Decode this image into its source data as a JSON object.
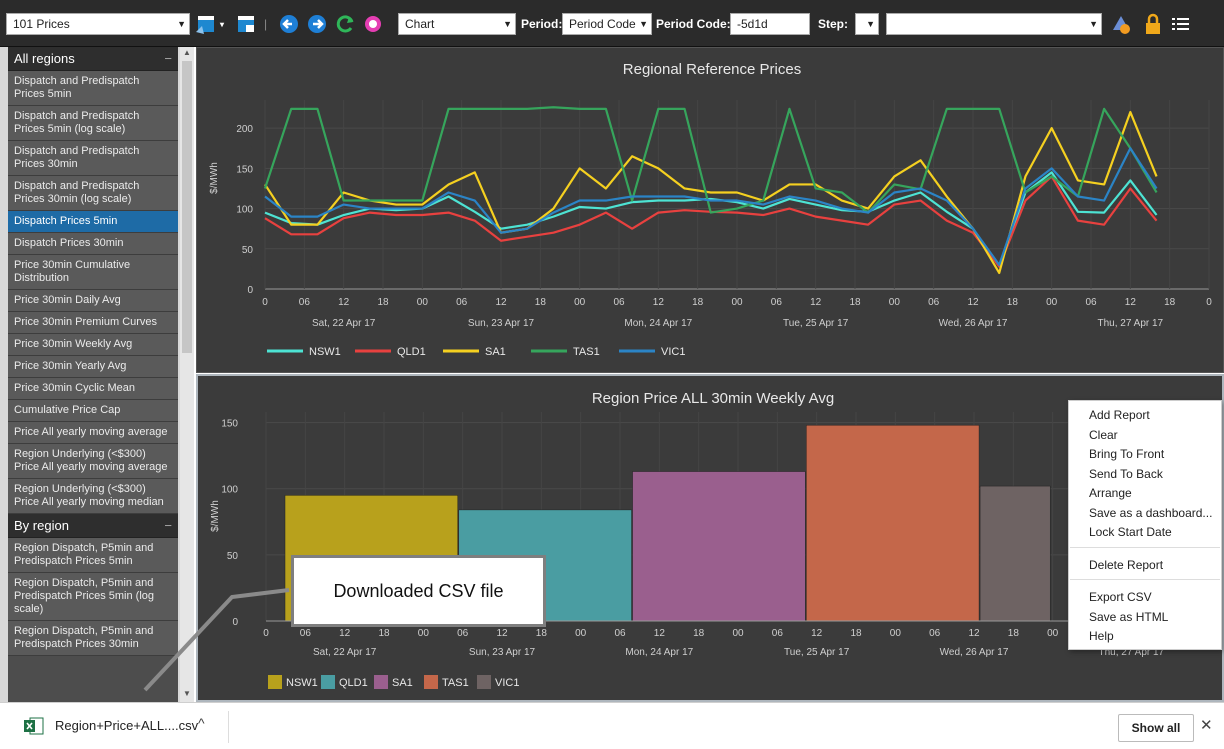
{
  "toolbar": {
    "report_select": "101 Prices",
    "view_select": "Chart",
    "period_label": "Period:",
    "period_value": "Period Code",
    "period_code_label": "Period Code:",
    "period_code_value": "-5d1d",
    "step_label": "Step:",
    "step_value": "",
    "extra_select": "",
    "icons": [
      "new-report-icon",
      "save-icon",
      "back-icon",
      "forward-icon",
      "refresh-icon",
      "record-icon",
      "share-icon",
      "lock-icon",
      "menu-icon"
    ]
  },
  "sidebar": {
    "groups": [
      {
        "title": "All regions",
        "items": [
          "Dispatch and Predispatch Prices 5min",
          "Dispatch and Predispatch Prices 5min (log scale)",
          "Dispatch and Predispatch Prices 30min",
          "Dispatch and Predispatch Prices 30min (log scale)",
          "Dispatch Prices 5min",
          "Dispatch Prices 30min",
          "Price 30min Cumulative Distribution",
          "Price 30min Daily Avg",
          "Price 30min Premium Curves",
          "Price 30min Weekly Avg",
          "Price 30min Yearly Avg",
          "Price 30min Cyclic Mean",
          "Cumulative Price Cap",
          "Price All yearly moving average",
          "Region Underlying (<$300) Price All yearly moving average",
          "Region Underlying (<$300) Price All yearly moving median"
        ]
      },
      {
        "title": "By region",
        "items": [
          "Region Dispatch, P5min and Predispatch Prices 5min",
          "Region Dispatch, P5min and Predispatch Prices 5min (log scale)",
          "Region Dispatch, P5min and Predispatch Prices 30min"
        ]
      }
    ],
    "selected_index": 4
  },
  "chart_data": [
    {
      "type": "line",
      "title": "Regional Reference Prices",
      "ylabel": "$/MWh",
      "ylim": [
        0,
        235
      ],
      "yticks": [
        0,
        50,
        100,
        150,
        200
      ],
      "xlim": [
        0,
        144
      ],
      "xticks": [
        "0",
        "06",
        "12",
        "18",
        "00",
        "06",
        "12",
        "18",
        "00",
        "06",
        "12",
        "18",
        "00",
        "06",
        "12",
        "18",
        "00",
        "06",
        "12",
        "18",
        "00",
        "06",
        "12",
        "18",
        "0"
      ],
      "day_labels": [
        "Sat, 22 Apr 17",
        "Sun, 23 Apr 17",
        "Mon, 24 Apr 17",
        "Tue, 25 Apr 17",
        "Wed, 26 Apr 17",
        "Thu, 27 Apr 17"
      ],
      "x_hours": [
        0,
        4,
        8,
        12,
        16,
        20,
        24,
        28,
        32,
        36,
        40,
        44,
        48,
        52,
        56,
        60,
        64,
        68,
        72,
        76,
        80,
        84,
        88,
        92,
        96,
        100,
        104,
        108,
        112,
        116,
        120,
        124,
        128,
        132,
        136
      ],
      "series": [
        {
          "name": "NSW1",
          "color": "#4de3d3",
          "values": [
            95,
            82,
            80,
            92,
            100,
            98,
            100,
            115,
            96,
            75,
            80,
            90,
            102,
            100,
            108,
            110,
            110,
            112,
            108,
            100,
            112,
            105,
            98,
            96,
            110,
            120,
            96,
            75,
            28,
            120,
            145,
            96,
            95,
            135,
            92
          ]
        },
        {
          "name": "QLD1",
          "color": "#e8413f",
          "values": [
            88,
            68,
            68,
            88,
            95,
            92,
            92,
            95,
            85,
            60,
            65,
            70,
            80,
            95,
            75,
            95,
            98,
            96,
            95,
            92,
            100,
            90,
            85,
            80,
            105,
            110,
            85,
            70,
            28,
            110,
            140,
            85,
            80,
            125,
            85
          ]
        },
        {
          "name": "SA1",
          "color": "#f5d020",
          "values": [
            130,
            80,
            80,
            120,
            110,
            105,
            105,
            130,
            145,
            70,
            75,
            100,
            150,
            125,
            165,
            150,
            125,
            120,
            120,
            110,
            130,
            130,
            110,
            100,
            140,
            160,
            115,
            75,
            20,
            140,
            200,
            135,
            130,
            220,
            140
          ]
        },
        {
          "name": "TAS1",
          "color": "#36a55c",
          "values": [
            125,
            224,
            224,
            110,
            110,
            110,
            110,
            224,
            224,
            224,
            224,
            226,
            224,
            224,
            110,
            224,
            224,
            95,
            100,
            110,
            224,
            125,
            120,
            95,
            130,
            124,
            224,
            224,
            224,
            120,
            140,
            115,
            224,
            175,
            120
          ]
        },
        {
          "name": "VIC1",
          "color": "#2b84c6",
          "values": [
            115,
            90,
            90,
            105,
            100,
            100,
            100,
            120,
            110,
            70,
            75,
            95,
            110,
            110,
            115,
            115,
            115,
            110,
            110,
            105,
            115,
            110,
            100,
            95,
            120,
            125,
            110,
            75,
            30,
            125,
            150,
            115,
            110,
            175,
            125
          ]
        }
      ]
    },
    {
      "type": "bar",
      "title": "Region Price ALL 30min Weekly Avg",
      "ylabel": "$/MWh",
      "ylim": [
        0,
        158
      ],
      "yticks": [
        0,
        50,
        100,
        150
      ],
      "categories": [
        "NSW1",
        "QLD1",
        "SA1",
        "TAS1",
        "VIC1"
      ],
      "colors": [
        "#b8a11c",
        "#4a9da2",
        "#9a5f8e",
        "#c4674a",
        "#6e6363"
      ],
      "values": [
        95,
        84,
        113,
        148,
        102
      ],
      "xticks": [
        "0",
        "06",
        "12",
        "18",
        "00",
        "06",
        "12",
        "18",
        "00",
        "06",
        "12",
        "18",
        "00",
        "06",
        "12",
        "18",
        "00",
        "06",
        "12",
        "18",
        "00",
        "06",
        "12",
        "18",
        "0"
      ],
      "day_labels": [
        "Sat, 22 Apr 17",
        "Sun, 23 Apr 17",
        "Mon, 24 Apr 17",
        "Tue, 25 Apr 17",
        "Wed, 26 Apr 17",
        "Thu, 27 Apr 17"
      ]
    }
  ],
  "context_menu": {
    "items_a": [
      "Add Report",
      "Clear",
      "Bring To Front",
      "Send To Back",
      "Arrange",
      "Save as a dashboard...",
      "Lock Start Date"
    ],
    "items_b": [
      "Delete Report"
    ],
    "items_c": [
      "Export CSV",
      "Save as HTML",
      "Help"
    ]
  },
  "callout": {
    "text": "Downloaded CSV file"
  },
  "download_bar": {
    "file_name": "Region+Price+ALL....csv",
    "show_all": "Show all",
    "caret": "^",
    "close": "✕"
  }
}
